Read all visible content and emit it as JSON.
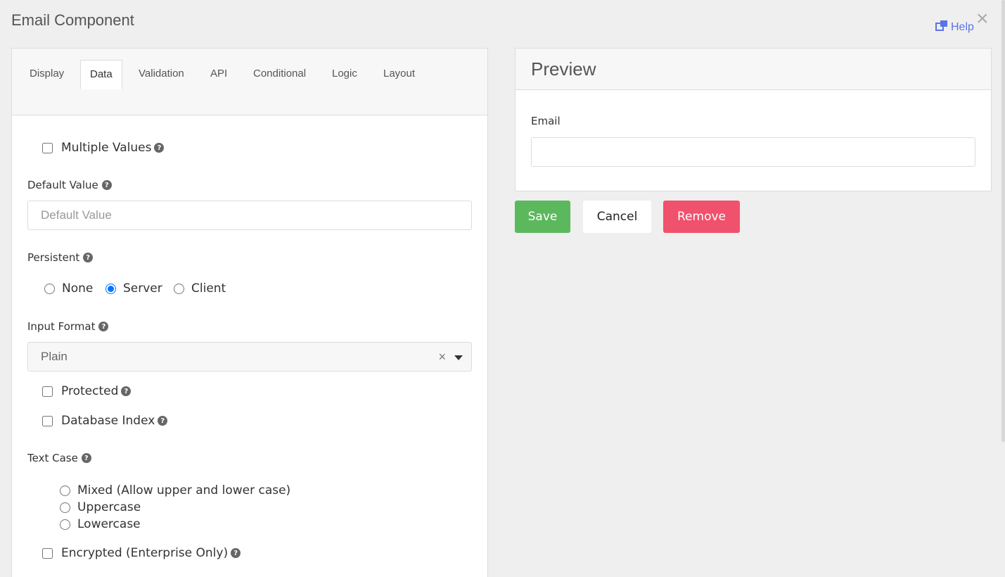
{
  "dialog": {
    "title": "Email Component",
    "help_label": "Help",
    "close_symbol": "×"
  },
  "tabs": [
    {
      "label": "Display"
    },
    {
      "label": "Data"
    },
    {
      "label": "Validation"
    },
    {
      "label": "API"
    },
    {
      "label": "Conditional"
    },
    {
      "label": "Logic"
    },
    {
      "label": "Layout"
    }
  ],
  "active_tab": "Data",
  "form": {
    "multiple_values": {
      "label": "Multiple Values",
      "checked": false
    },
    "default_value": {
      "label": "Default Value",
      "placeholder": "Default Value",
      "value": ""
    },
    "persistent": {
      "label": "Persistent",
      "options": [
        "None",
        "Server",
        "Client"
      ],
      "selected": "Server"
    },
    "input_format": {
      "label": "Input Format",
      "value": "Plain",
      "clear_symbol": "×"
    },
    "protected": {
      "label": "Protected",
      "checked": false
    },
    "database_index": {
      "label": "Database Index",
      "checked": false
    },
    "text_case": {
      "label": "Text Case",
      "options": [
        "Mixed (Allow upper and lower case)",
        "Uppercase",
        "Lowercase"
      ],
      "selected": null
    },
    "encrypted": {
      "label": "Encrypted (Enterprise Only)",
      "checked": false
    },
    "help_icon_symbol": "?"
  },
  "preview": {
    "title": "Preview",
    "field_label": "Email",
    "field_value": ""
  },
  "buttons": {
    "save": "Save",
    "cancel": "Cancel",
    "remove": "Remove"
  },
  "colors": {
    "save": "#5cb85c",
    "remove": "#f0516c",
    "link": "#5b73e8",
    "radio_checked": "#1a73e8"
  }
}
